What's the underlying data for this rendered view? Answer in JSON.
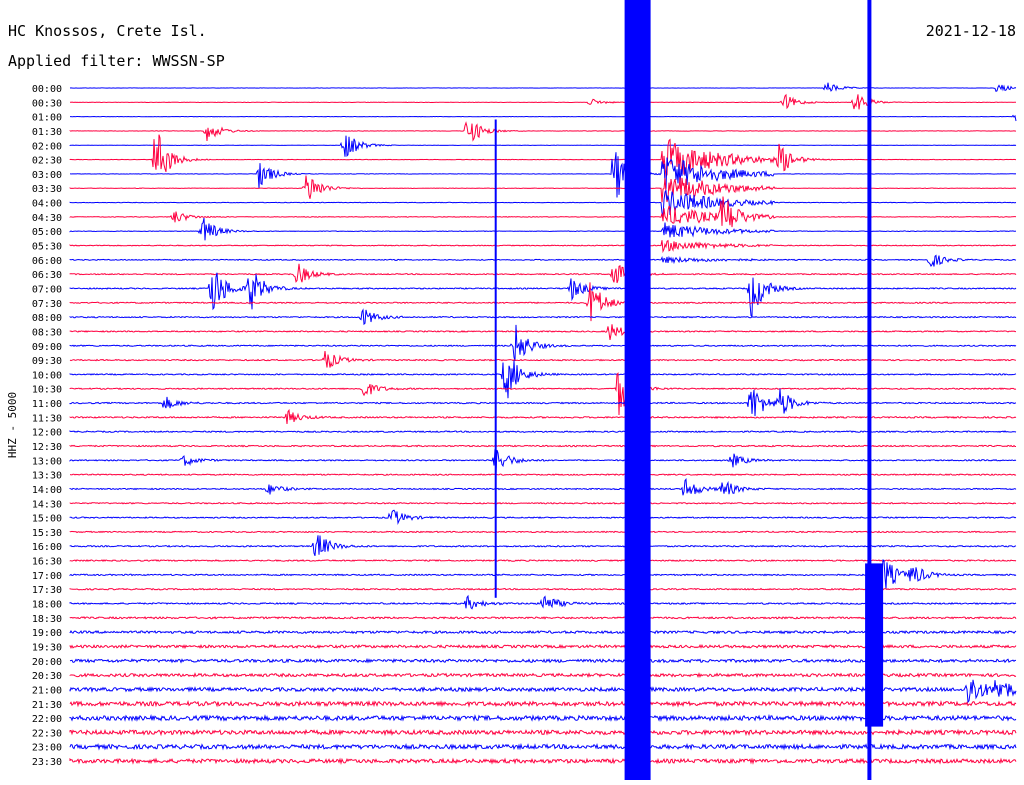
{
  "header": {
    "station": "HC Knossos, Crete Isl.",
    "date": "2021-12-18",
    "filter": "Applied filter: WWSSN-SP"
  },
  "chart_data": {
    "type": "line",
    "title": "HC Knossos, Crete Isl.",
    "ylabel": "HHZ - 5000",
    "trace_colors": [
      "#0000ff",
      "#ff0040"
    ],
    "grid": false,
    "time_labels": [
      "00:00",
      "00:30",
      "01:00",
      "01:30",
      "02:00",
      "02:30",
      "03:00",
      "03:30",
      "04:00",
      "04:30",
      "05:00",
      "05:30",
      "06:00",
      "06:30",
      "07:00",
      "07:30",
      "08:00",
      "08:30",
      "09:00",
      "09:30",
      "10:00",
      "10:30",
      "11:00",
      "11:30",
      "12:00",
      "12:30",
      "13:00",
      "13:30",
      "14:00",
      "14:30",
      "15:00",
      "15:30",
      "16:00",
      "16:30",
      "17:00",
      "17:30",
      "18:00",
      "18:30",
      "19:00",
      "19:30",
      "20:00",
      "20:30",
      "21:00",
      "21:30",
      "22:00",
      "22:30",
      "23:00",
      "23:30"
    ],
    "noise_level": [
      0.05,
      0.07,
      0.06,
      0.07,
      0.06,
      0.07,
      0.06,
      0.08,
      0.08,
      0.1,
      0.1,
      0.14,
      0.16,
      0.18,
      0.2,
      0.2,
      0.2,
      0.2,
      0.2,
      0.2,
      0.2,
      0.2,
      0.22,
      0.24,
      0.22,
      0.22,
      0.2,
      0.2,
      0.2,
      0.2,
      0.2,
      0.2,
      0.22,
      0.22,
      0.22,
      0.22,
      0.24,
      0.3,
      0.4,
      0.45,
      0.5,
      0.5,
      0.6,
      0.7,
      0.75,
      0.7,
      0.7,
      0.65
    ],
    "events": [
      {
        "line": 0,
        "pos": 0.8,
        "amp": 0.5
      },
      {
        "line": 0,
        "pos": 0.98,
        "amp": 0.4
      },
      {
        "line": 1,
        "pos": 0.755,
        "amp": 0.7
      },
      {
        "line": 1,
        "pos": 0.83,
        "amp": 0.9
      },
      {
        "line": 1,
        "pos": 0.55,
        "amp": 0.3
      },
      {
        "line": 2,
        "pos": 1.0,
        "amp": 0.4
      },
      {
        "line": 3,
        "pos": 0.145,
        "amp": 0.9
      },
      {
        "line": 3,
        "pos": 0.42,
        "amp": 1.4
      },
      {
        "line": 4,
        "pos": 0.29,
        "amp": 1.3
      },
      {
        "line": 5,
        "pos": 0.09,
        "amp": 3.0
      },
      {
        "line": 5,
        "pos": 0.75,
        "amp": 1.5
      },
      {
        "line": 6,
        "pos": 0.2,
        "amp": 1.3
      },
      {
        "line": 6,
        "pos": 0.575,
        "amp": 2.8
      },
      {
        "line": 7,
        "pos": 0.25,
        "amp": 1.6
      },
      {
        "line": 9,
        "pos": 0.11,
        "amp": 0.6
      },
      {
        "line": 9,
        "pos": 0.69,
        "amp": 2.0
      },
      {
        "line": 10,
        "pos": 0.14,
        "amp": 1.3
      },
      {
        "line": 12,
        "pos": 0.91,
        "amp": 0.7
      },
      {
        "line": 13,
        "pos": 0.24,
        "amp": 1.0
      },
      {
        "line": 13,
        "pos": 0.575,
        "amp": 1.2
      },
      {
        "line": 14,
        "pos": 0.15,
        "amp": 2.5
      },
      {
        "line": 14,
        "pos": 0.19,
        "amp": 2.0
      },
      {
        "line": 14,
        "pos": 0.53,
        "amp": 1.0
      },
      {
        "line": 14,
        "pos": 0.72,
        "amp": 2.5
      },
      {
        "line": 15,
        "pos": 0.55,
        "amp": 2.0
      },
      {
        "line": 16,
        "pos": 0.31,
        "amp": 0.8
      },
      {
        "line": 17,
        "pos": 0.57,
        "amp": 0.8
      },
      {
        "line": 18,
        "pos": 0.47,
        "amp": 2.0
      },
      {
        "line": 19,
        "pos": 0.27,
        "amp": 0.9
      },
      {
        "line": 20,
        "pos": 0.46,
        "amp": 2.5
      },
      {
        "line": 21,
        "pos": 0.58,
        "amp": 2.3
      },
      {
        "line": 21,
        "pos": 0.31,
        "amp": 0.8
      },
      {
        "line": 22,
        "pos": 0.72,
        "amp": 1.8
      },
      {
        "line": 22,
        "pos": 0.75,
        "amp": 1.2
      },
      {
        "line": 22,
        "pos": 0.1,
        "amp": 0.6
      },
      {
        "line": 23,
        "pos": 0.23,
        "amp": 0.6
      },
      {
        "line": 26,
        "pos": 0.45,
        "amp": 1.2
      },
      {
        "line": 26,
        "pos": 0.12,
        "amp": 0.5
      },
      {
        "line": 26,
        "pos": 0.7,
        "amp": 0.6
      },
      {
        "line": 28,
        "pos": 0.65,
        "amp": 1.0
      },
      {
        "line": 28,
        "pos": 0.69,
        "amp": 0.8
      },
      {
        "line": 28,
        "pos": 0.21,
        "amp": 0.5
      },
      {
        "line": 30,
        "pos": 0.34,
        "amp": 0.8
      },
      {
        "line": 32,
        "pos": 0.26,
        "amp": 1.3
      },
      {
        "line": 34,
        "pos": 0.86,
        "amp": 1.6
      },
      {
        "line": 34,
        "pos": 0.89,
        "amp": 0.9
      },
      {
        "line": 36,
        "pos": 0.5,
        "amp": 0.9
      },
      {
        "line": 36,
        "pos": 0.42,
        "amp": 0.6
      },
      {
        "line": 42,
        "pos": 0.95,
        "amp": 1.6
      },
      {
        "line": 42,
        "pos": 0.98,
        "amp": 1.2
      }
    ],
    "spikes": [
      {
        "pos": 0.6,
        "start": 0,
        "end": 47,
        "width": 26,
        "color": "#0000ff"
      },
      {
        "pos": 0.845,
        "start": 0,
        "end": 47,
        "width": 4,
        "color": "#0000ff"
      },
      {
        "pos": 0.45,
        "start": 3,
        "end": 35,
        "width": 2,
        "color": "#0000ff"
      },
      {
        "pos": 0.85,
        "start": 34,
        "end": 44,
        "width": 18,
        "color": "#0000ff"
      }
    ],
    "coda": {
      "pos": 0.625,
      "start": 5,
      "end": 12,
      "amp": 3.0
    }
  }
}
